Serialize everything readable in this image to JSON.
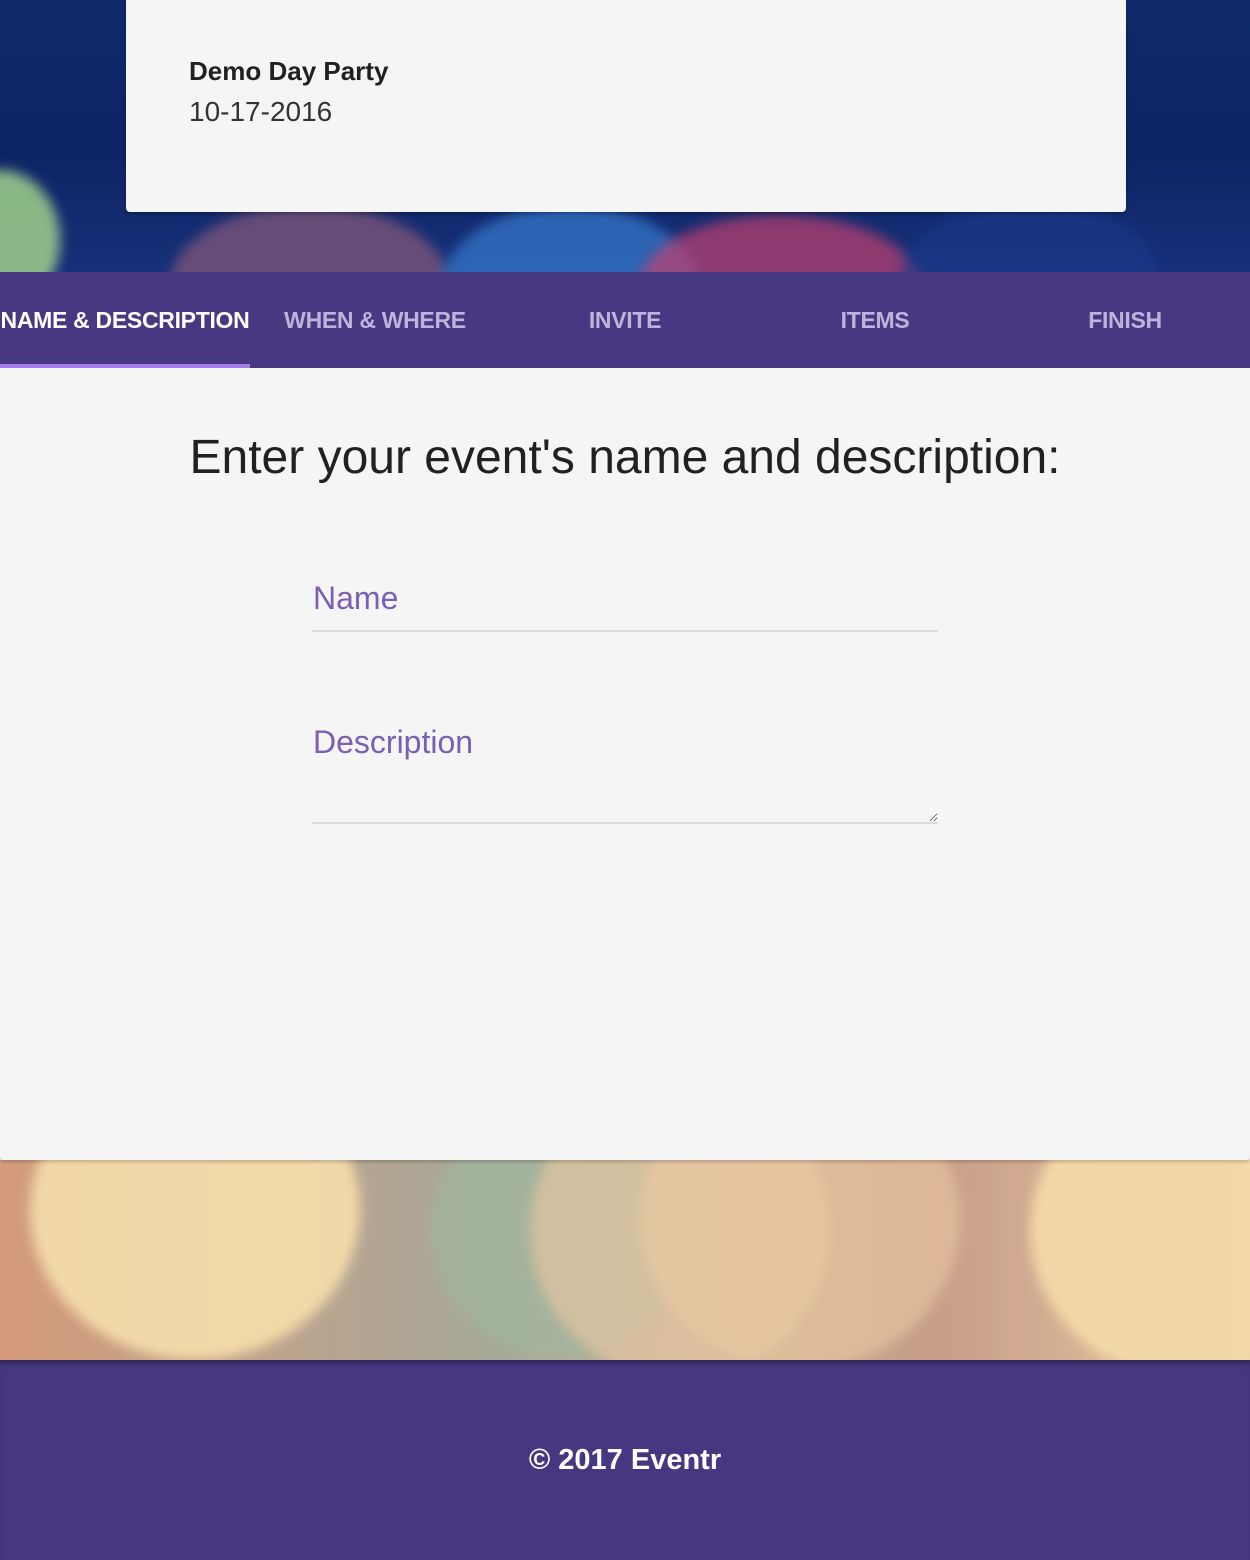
{
  "event": {
    "title": "Demo Day Party",
    "date": "10-17-2016"
  },
  "tabs": [
    {
      "label": "NAME & DESCRIPTION",
      "active": true
    },
    {
      "label": "WHEN & WHERE",
      "active": false
    },
    {
      "label": "INVITE",
      "active": false
    },
    {
      "label": "ITEMS",
      "active": false
    },
    {
      "label": "FINISH",
      "active": false
    }
  ],
  "form": {
    "heading": "Enter your event's name and description:",
    "name_label": "Name",
    "name_value": "",
    "description_label": "Description",
    "description_value": ""
  },
  "footer": {
    "copyright": "© 2017 Eventr"
  },
  "colors": {
    "brand_purple": "#483882",
    "tab_indicator": "#a47de8",
    "field_label": "#7b5fb5",
    "panel_bg": "#f5f5f5"
  }
}
